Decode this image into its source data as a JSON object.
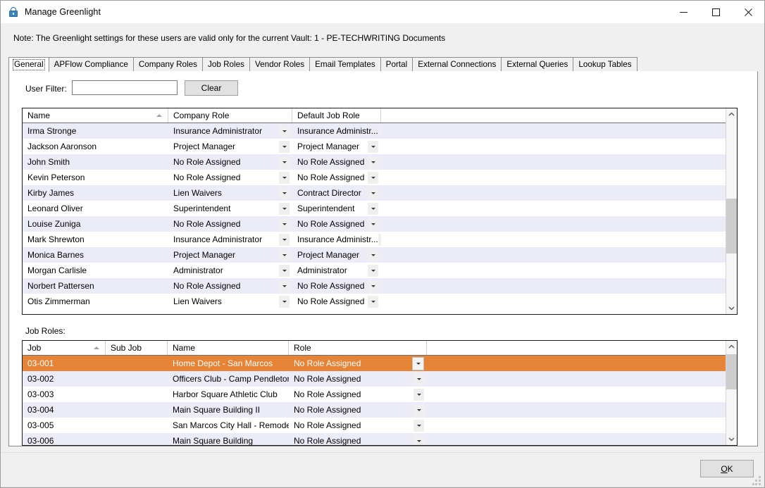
{
  "window": {
    "title": "Manage Greenlight",
    "icon": "padlock-icon",
    "minimize_label": "Minimize",
    "maximize_label": "Maximize",
    "close_label": "Close"
  },
  "note": "Note:  The Greenlight settings for these users are valid only for the current Vault: 1 - PE-TECHWRITING Documents",
  "tabs": [
    {
      "label": "General",
      "selected": true
    },
    {
      "label": "APFlow Compliance",
      "selected": false
    },
    {
      "label": "Company Roles",
      "selected": false
    },
    {
      "label": "Job Roles",
      "selected": false
    },
    {
      "label": "Vendor Roles",
      "selected": false
    },
    {
      "label": "Email Templates",
      "selected": false
    },
    {
      "label": "Portal",
      "selected": false
    },
    {
      "label": "External Connections",
      "selected": false
    },
    {
      "label": "External Queries",
      "selected": false
    },
    {
      "label": "Lookup Tables",
      "selected": false
    }
  ],
  "filter": {
    "label": "User Filter:",
    "value": "",
    "placeholder": "",
    "clear_label": "Clear"
  },
  "users_grid": {
    "columns": [
      "Name",
      "Company Role",
      "Default Job Role",
      ""
    ],
    "sorted_column": "Name",
    "sort_direction": "asc",
    "rows": [
      {
        "name": "Irma Stronge",
        "company_role": "Insurance Administrator",
        "default_job_role": "Insurance Administr..."
      },
      {
        "name": "Jackson Aaronson",
        "company_role": "Project Manager",
        "default_job_role": "Project Manager"
      },
      {
        "name": "John Smith",
        "company_role": "No Role Assigned",
        "default_job_role": "No Role Assigned"
      },
      {
        "name": "Kevin Peterson",
        "company_role": "No Role Assigned",
        "default_job_role": "No Role Assigned"
      },
      {
        "name": "Kirby James",
        "company_role": "Lien Waivers",
        "default_job_role": "Contract Director"
      },
      {
        "name": "Leonard Oliver",
        "company_role": "Superintendent",
        "default_job_role": "Superintendent"
      },
      {
        "name": "Louise Zuniga",
        "company_role": "No Role Assigned",
        "default_job_role": "No Role Assigned"
      },
      {
        "name": "Mark Shrewton",
        "company_role": "Insurance Administrator",
        "default_job_role": "Insurance Administr..."
      },
      {
        "name": "Monica Barnes",
        "company_role": "Project Manager",
        "default_job_role": "Project Manager"
      },
      {
        "name": "Morgan Carlisle",
        "company_role": "Administrator",
        "default_job_role": "Administrator"
      },
      {
        "name": "Norbert Pattersen",
        "company_role": "No Role Assigned",
        "default_job_role": "No Role Assigned"
      },
      {
        "name": "Otis Zimmerman",
        "company_role": "Lien Waivers",
        "default_job_role": "No Role Assigned"
      }
    ]
  },
  "job_roles": {
    "section_label": "Job Roles:",
    "columns": [
      "Job",
      "Sub Job",
      "Name",
      "Role",
      ""
    ],
    "sorted_column": "Job",
    "sort_direction": "asc",
    "rows": [
      {
        "job": "03-001",
        "sub_job": "",
        "name": "Home Depot - San Marcos",
        "role": "No Role Assigned",
        "selected": true
      },
      {
        "job": "03-002",
        "sub_job": "",
        "name": "Officers Club - Camp Pendleton",
        "role": "No Role Assigned",
        "selected": false
      },
      {
        "job": "03-003",
        "sub_job": "",
        "name": "Harbor Square Athletic Club",
        "role": "No Role Assigned",
        "selected": false
      },
      {
        "job": "03-004",
        "sub_job": "",
        "name": "Main Square Building II",
        "role": "No Role Assigned",
        "selected": false
      },
      {
        "job": "03-005",
        "sub_job": "",
        "name": "San Marcos City Hall - Remodel",
        "role": "No Role Assigned",
        "selected": false
      },
      {
        "job": "03-006",
        "sub_job": "",
        "name": "Main Square Building",
        "role": "No Role Assigned",
        "selected": false
      }
    ]
  },
  "footer": {
    "ok_label": "OK",
    "ok_accelerator": "O"
  },
  "colors": {
    "selection": "#e58337",
    "alt_row": "#ececf8",
    "row": "#ffffff",
    "window_bg": "#f0f0f0",
    "button_face": "#e1e1e1",
    "scroll_thumb": "#cdcdcd"
  }
}
